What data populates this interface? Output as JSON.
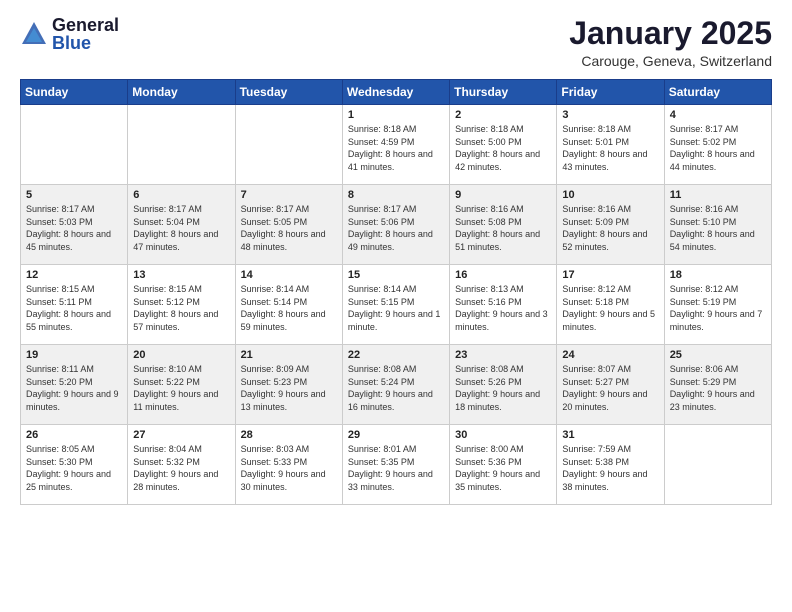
{
  "header": {
    "logo_general": "General",
    "logo_blue": "Blue",
    "month_title": "January 2025",
    "location": "Carouge, Geneva, Switzerland"
  },
  "weekdays": [
    "Sunday",
    "Monday",
    "Tuesday",
    "Wednesday",
    "Thursday",
    "Friday",
    "Saturday"
  ],
  "weeks": [
    [
      {
        "day": "",
        "sunrise": "",
        "sunset": "",
        "daylight": ""
      },
      {
        "day": "",
        "sunrise": "",
        "sunset": "",
        "daylight": ""
      },
      {
        "day": "",
        "sunrise": "",
        "sunset": "",
        "daylight": ""
      },
      {
        "day": "1",
        "sunrise": "Sunrise: 8:18 AM",
        "sunset": "Sunset: 4:59 PM",
        "daylight": "Daylight: 8 hours and 41 minutes."
      },
      {
        "day": "2",
        "sunrise": "Sunrise: 8:18 AM",
        "sunset": "Sunset: 5:00 PM",
        "daylight": "Daylight: 8 hours and 42 minutes."
      },
      {
        "day": "3",
        "sunrise": "Sunrise: 8:18 AM",
        "sunset": "Sunset: 5:01 PM",
        "daylight": "Daylight: 8 hours and 43 minutes."
      },
      {
        "day": "4",
        "sunrise": "Sunrise: 8:17 AM",
        "sunset": "Sunset: 5:02 PM",
        "daylight": "Daylight: 8 hours and 44 minutes."
      }
    ],
    [
      {
        "day": "5",
        "sunrise": "Sunrise: 8:17 AM",
        "sunset": "Sunset: 5:03 PM",
        "daylight": "Daylight: 8 hours and 45 minutes."
      },
      {
        "day": "6",
        "sunrise": "Sunrise: 8:17 AM",
        "sunset": "Sunset: 5:04 PM",
        "daylight": "Daylight: 8 hours and 47 minutes."
      },
      {
        "day": "7",
        "sunrise": "Sunrise: 8:17 AM",
        "sunset": "Sunset: 5:05 PM",
        "daylight": "Daylight: 8 hours and 48 minutes."
      },
      {
        "day": "8",
        "sunrise": "Sunrise: 8:17 AM",
        "sunset": "Sunset: 5:06 PM",
        "daylight": "Daylight: 8 hours and 49 minutes."
      },
      {
        "day": "9",
        "sunrise": "Sunrise: 8:16 AM",
        "sunset": "Sunset: 5:08 PM",
        "daylight": "Daylight: 8 hours and 51 minutes."
      },
      {
        "day": "10",
        "sunrise": "Sunrise: 8:16 AM",
        "sunset": "Sunset: 5:09 PM",
        "daylight": "Daylight: 8 hours and 52 minutes."
      },
      {
        "day": "11",
        "sunrise": "Sunrise: 8:16 AM",
        "sunset": "Sunset: 5:10 PM",
        "daylight": "Daylight: 8 hours and 54 minutes."
      }
    ],
    [
      {
        "day": "12",
        "sunrise": "Sunrise: 8:15 AM",
        "sunset": "Sunset: 5:11 PM",
        "daylight": "Daylight: 8 hours and 55 minutes."
      },
      {
        "day": "13",
        "sunrise": "Sunrise: 8:15 AM",
        "sunset": "Sunset: 5:12 PM",
        "daylight": "Daylight: 8 hours and 57 minutes."
      },
      {
        "day": "14",
        "sunrise": "Sunrise: 8:14 AM",
        "sunset": "Sunset: 5:14 PM",
        "daylight": "Daylight: 8 hours and 59 minutes."
      },
      {
        "day": "15",
        "sunrise": "Sunrise: 8:14 AM",
        "sunset": "Sunset: 5:15 PM",
        "daylight": "Daylight: 9 hours and 1 minute."
      },
      {
        "day": "16",
        "sunrise": "Sunrise: 8:13 AM",
        "sunset": "Sunset: 5:16 PM",
        "daylight": "Daylight: 9 hours and 3 minutes."
      },
      {
        "day": "17",
        "sunrise": "Sunrise: 8:12 AM",
        "sunset": "Sunset: 5:18 PM",
        "daylight": "Daylight: 9 hours and 5 minutes."
      },
      {
        "day": "18",
        "sunrise": "Sunrise: 8:12 AM",
        "sunset": "Sunset: 5:19 PM",
        "daylight": "Daylight: 9 hours and 7 minutes."
      }
    ],
    [
      {
        "day": "19",
        "sunrise": "Sunrise: 8:11 AM",
        "sunset": "Sunset: 5:20 PM",
        "daylight": "Daylight: 9 hours and 9 minutes."
      },
      {
        "day": "20",
        "sunrise": "Sunrise: 8:10 AM",
        "sunset": "Sunset: 5:22 PM",
        "daylight": "Daylight: 9 hours and 11 minutes."
      },
      {
        "day": "21",
        "sunrise": "Sunrise: 8:09 AM",
        "sunset": "Sunset: 5:23 PM",
        "daylight": "Daylight: 9 hours and 13 minutes."
      },
      {
        "day": "22",
        "sunrise": "Sunrise: 8:08 AM",
        "sunset": "Sunset: 5:24 PM",
        "daylight": "Daylight: 9 hours and 16 minutes."
      },
      {
        "day": "23",
        "sunrise": "Sunrise: 8:08 AM",
        "sunset": "Sunset: 5:26 PM",
        "daylight": "Daylight: 9 hours and 18 minutes."
      },
      {
        "day": "24",
        "sunrise": "Sunrise: 8:07 AM",
        "sunset": "Sunset: 5:27 PM",
        "daylight": "Daylight: 9 hours and 20 minutes."
      },
      {
        "day": "25",
        "sunrise": "Sunrise: 8:06 AM",
        "sunset": "Sunset: 5:29 PM",
        "daylight": "Daylight: 9 hours and 23 minutes."
      }
    ],
    [
      {
        "day": "26",
        "sunrise": "Sunrise: 8:05 AM",
        "sunset": "Sunset: 5:30 PM",
        "daylight": "Daylight: 9 hours and 25 minutes."
      },
      {
        "day": "27",
        "sunrise": "Sunrise: 8:04 AM",
        "sunset": "Sunset: 5:32 PM",
        "daylight": "Daylight: 9 hours and 28 minutes."
      },
      {
        "day": "28",
        "sunrise": "Sunrise: 8:03 AM",
        "sunset": "Sunset: 5:33 PM",
        "daylight": "Daylight: 9 hours and 30 minutes."
      },
      {
        "day": "29",
        "sunrise": "Sunrise: 8:01 AM",
        "sunset": "Sunset: 5:35 PM",
        "daylight": "Daylight: 9 hours and 33 minutes."
      },
      {
        "day": "30",
        "sunrise": "Sunrise: 8:00 AM",
        "sunset": "Sunset: 5:36 PM",
        "daylight": "Daylight: 9 hours and 35 minutes."
      },
      {
        "day": "31",
        "sunrise": "Sunrise: 7:59 AM",
        "sunset": "Sunset: 5:38 PM",
        "daylight": "Daylight: 9 hours and 38 minutes."
      },
      {
        "day": "",
        "sunrise": "",
        "sunset": "",
        "daylight": ""
      }
    ]
  ]
}
